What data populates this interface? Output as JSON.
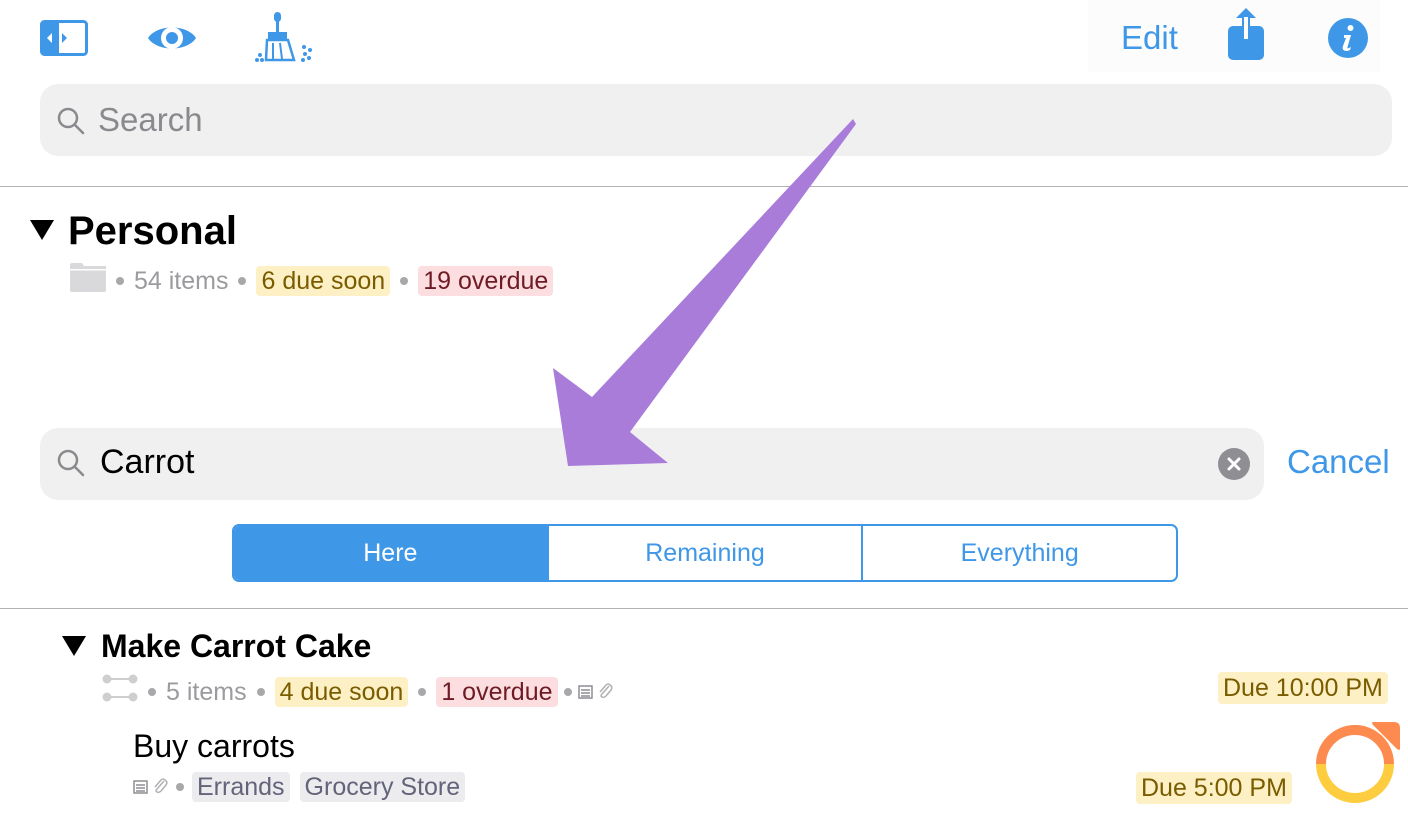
{
  "toolbar": {
    "left_icons": [
      "sidebar-toggle-icon",
      "eye-icon",
      "broom-clean-up-icon"
    ],
    "edit_label": "Edit",
    "right_icons": [
      "share-icon",
      "info-icon"
    ]
  },
  "top_search": {
    "placeholder": "Search",
    "icon": "search-icon"
  },
  "project": {
    "title": "Personal",
    "icon": "folder-icon",
    "item_count": "54 items",
    "due_soon": "6 due soon",
    "overdue": "19 overdue"
  },
  "search": {
    "value": "Carrot",
    "clear_icon": "clear-icon",
    "cancel_label": "Cancel"
  },
  "scope_segments": [
    {
      "label": "Here",
      "selected": true
    },
    {
      "label": "Remaining",
      "selected": false
    },
    {
      "label": "Everything",
      "selected": false
    }
  ],
  "results": {
    "group": {
      "title": "Make Carrot Cake",
      "icon": "sequential-action-group-icon",
      "item_count": "5 items",
      "due_soon": "4 due soon",
      "overdue": "1 overdue",
      "has_note": true,
      "has_attachment": true,
      "due": "Due 10:00 PM"
    },
    "task": {
      "title": "Buy carrots",
      "has_note": true,
      "has_attachment": true,
      "tags": [
        "Errands",
        "Grocery Store"
      ],
      "due": "Due 5:00 PM",
      "status_icon": "due-soon-checkbox-icon"
    }
  },
  "colors": {
    "accent": "#3f97e8",
    "due_soon_bg": "#fdf0c4",
    "due_soon_text": "#7a5c00",
    "overdue_bg": "#fcdde0",
    "overdue_text": "#6e1b24",
    "annotation_arrow": "#a97cda",
    "checkbox_orange": "#fd8b4f",
    "checkbox_yellow": "#fdcd3f"
  }
}
